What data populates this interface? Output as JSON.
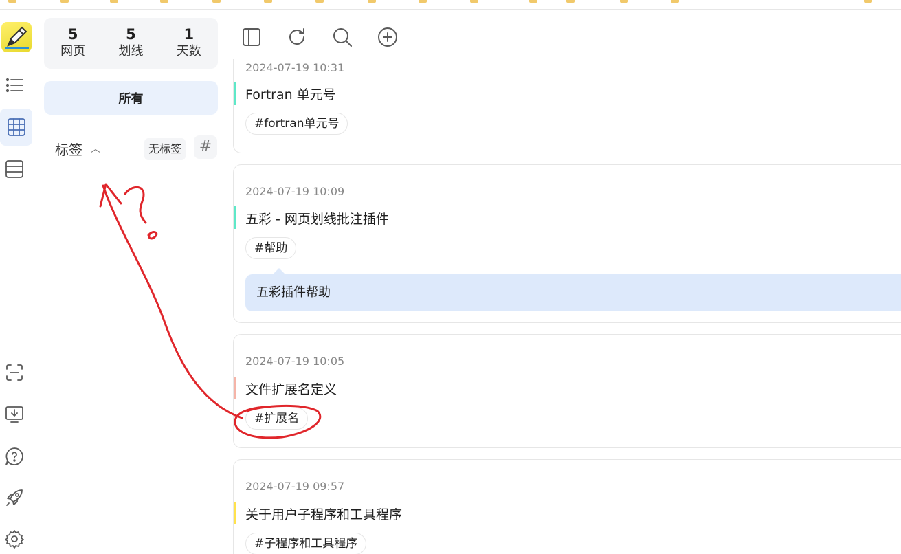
{
  "sidebar": {
    "stats": [
      {
        "value": "5",
        "label": "网页"
      },
      {
        "value": "5",
        "label": "划线"
      },
      {
        "value": "1",
        "label": "天数"
      }
    ],
    "all_label": "所有",
    "tags_title": "标签",
    "no_tag_label": "无标签",
    "hash_glyph": "#"
  },
  "cards": [
    {
      "time": "2024-07-19 10:31",
      "title": "Fortran 单元号",
      "tag": "#fortran单元号",
      "accent": "#5ee8c8"
    },
    {
      "time": "2024-07-19 10:09",
      "title": "五彩 - 网页划线批注插件",
      "tag": "#帮助",
      "note": "五彩插件帮助",
      "accent": "#5ee8c8"
    },
    {
      "time": "2024-07-19 10:05",
      "title": "文件扩展名定义",
      "tag": "#扩展名",
      "accent": "#f5b4a8"
    },
    {
      "time": "2024-07-19 09:57",
      "title": "关于用户子程序和工具程序",
      "tag": "#子程序和工具程序",
      "accent": "#ffe24d"
    }
  ],
  "annotation": {
    "ink_color": "#e0262b",
    "question_glyph": "?"
  }
}
